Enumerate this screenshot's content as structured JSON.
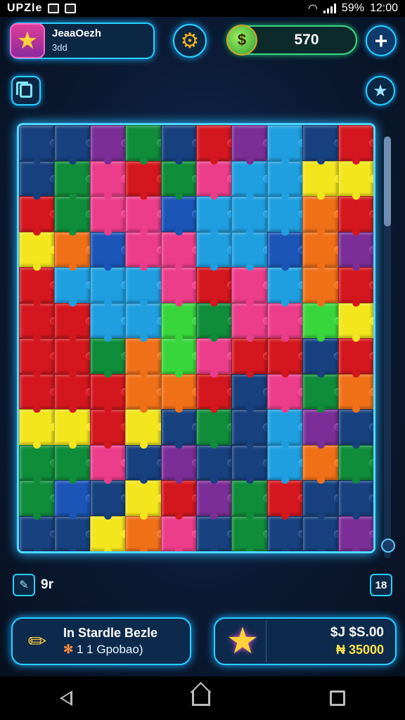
{
  "status_bar": {
    "left_text": "UPZle",
    "battery": "59%",
    "time": "12:00"
  },
  "header": {
    "player_name": "JeaaOezh",
    "player_sub": "3dd",
    "coins": "570",
    "profile_icon": "star-icon",
    "settings_icon": "gear-icon",
    "coin_icon": "coin-icon",
    "add_icon": "plus-icon"
  },
  "toolbar": {
    "left_icon": "copy-icon",
    "right_icon": "star-icon"
  },
  "board": {
    "palette": {
      "B": "#17417f",
      "R": "#d4171e",
      "G": "#0f8d3a",
      "Y": "#f3e61c",
      "P": "#7b2e97",
      "K": "#ec3d8a",
      "C": "#1f9fe0",
      "O": "#f07018",
      "L": "#38d63c",
      "N": "#1c55b8"
    },
    "rows": [
      "BBPGBRPCBR",
      "BGKRGKCCYY",
      "RGKKNCCCOR",
      "YONKKCCNOP",
      "RCCCKRKCOR",
      "RRCCLGKKLY",
      "RRGOLKRRBR",
      "RRROORBKGO",
      "YYRYBGBCPB",
      "GGKBPBBCOG",
      "GNBYRPGRBB",
      "BBYOKBGBBP"
    ]
  },
  "footer_hint": {
    "icon": "pencil-icon",
    "text": "9r",
    "count": "18"
  },
  "cards": {
    "left": {
      "icon": "pencil-icon",
      "title": "In Stardle Bezle",
      "sub_marker": "✻",
      "sub": "1 1 Gpobao)"
    },
    "right": {
      "icon": "star-icon",
      "price": "$J $S.00",
      "price_alt": "₦ 35000"
    }
  },
  "nav": {
    "back_icon": "back-icon",
    "home_icon": "home-icon",
    "recent_icon": "recent-apps-icon"
  }
}
